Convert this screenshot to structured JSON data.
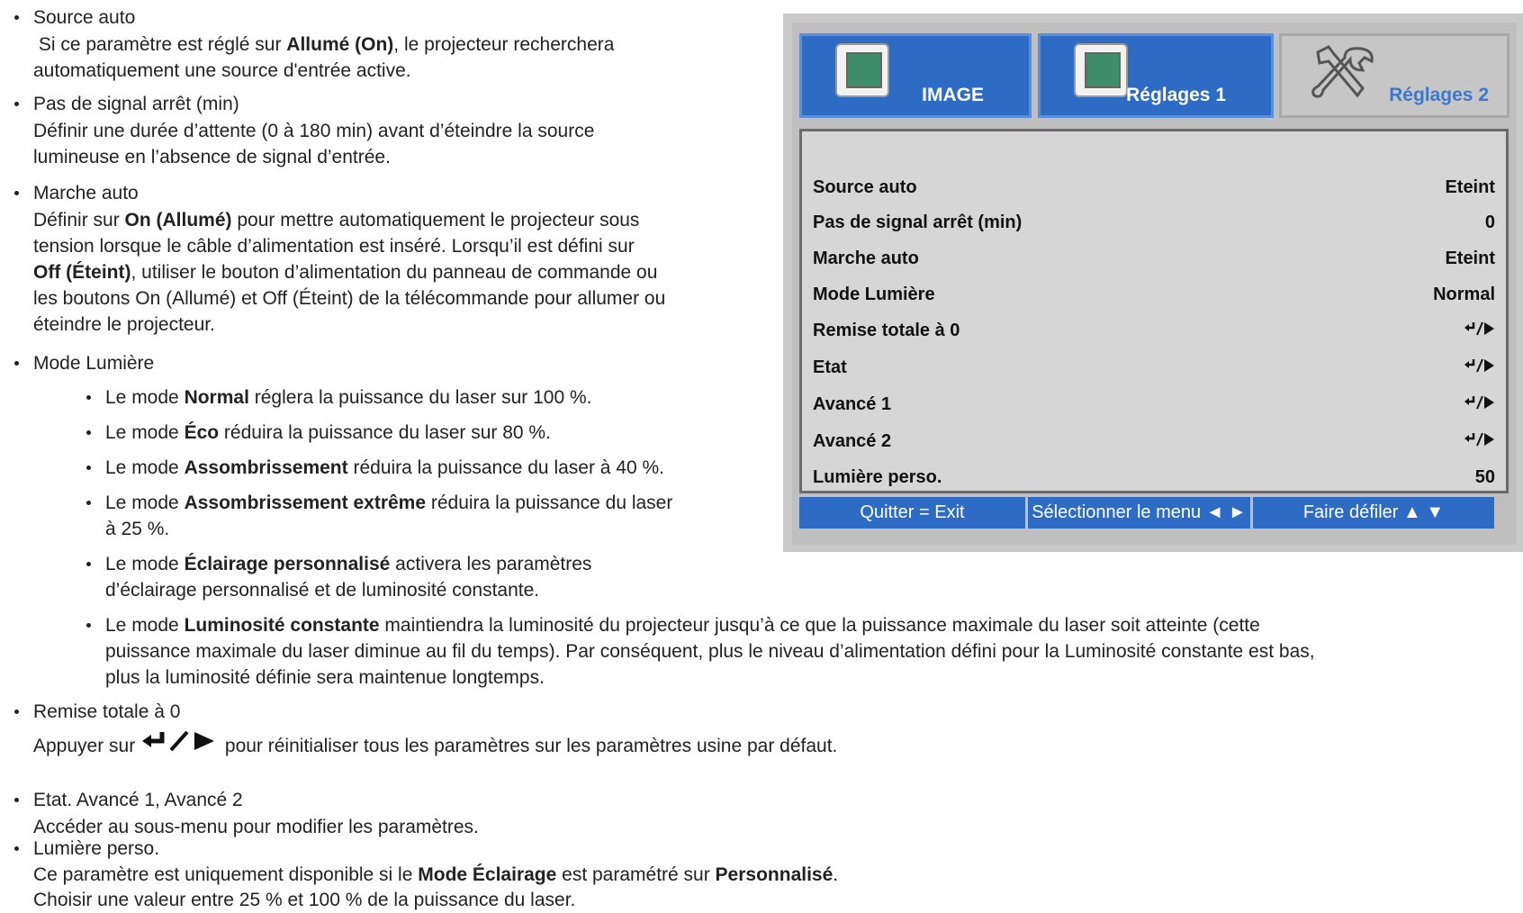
{
  "doc": {
    "b1": {
      "title": "Source auto",
      "l1a": " Si ce paramètre est réglé sur ",
      "l1b": "Allumé (On)",
      "l1c": ", le projecteur recherchera",
      "l2": "automatiquement une source d'entrée active."
    },
    "b2": {
      "title": "Pas de signal arrêt (min)",
      "l1": "Définir une durée d’attente (0 à 180 min) avant d’éteindre la source",
      "l2": "lumineuse en l’absence de signal d’entrée."
    },
    "b3": {
      "title": "Marche auto",
      "l1a": "Définir sur ",
      "l1b": "On (Allumé)",
      "l1c": " pour mettre automatiquement le projecteur sous",
      "l2": "tension lorsque le câble d’alimentation est inséré. Lorsqu’il est défini sur",
      "l3a": "Off (Éteint)",
      "l3b": ", utiliser le bouton d’alimentation du panneau de commande ou",
      "l4": "les boutons On (Allumé) et Off (Éteint) de la télécommande pour allumer ou",
      "l5": "éteindre le projecteur."
    },
    "b4": {
      "title": "Mode Lumière",
      "s1a": "Le mode ",
      "s1b": "Normal",
      "s1c": " réglera la puissance du laser sur 100 %.",
      "s2a": "Le mode ",
      "s2b": "Éco",
      "s2c": " réduira la puissance du laser sur 80 %.",
      "s3a": "Le mode ",
      "s3b": "Assombrissement",
      "s3c": " réduira la puissance du laser à 40 %.",
      "s4a": "Le mode ",
      "s4b": "Assombrissement extrême",
      "s4c": " réduira la puissance du laser",
      "s4d": "à 25 %.",
      "s5a": "Le mode ",
      "s5b": "Éclairage personnalisé",
      "s5c": " activera les paramètres",
      "s5d": "d’éclairage personnalisé et de luminosité constante.",
      "s6a": "Le mode ",
      "s6b": "Luminosité constante",
      "s6c": " maintiendra la luminosité du projecteur jusqu’à ce que la puissance maximale du laser soit atteinte (cette",
      "s6d": "puissance maximale du laser diminue au fil du temps). Par conséquent, plus le niveau d’alimentation défini pour la Luminosité constante est bas,",
      "s6e": "plus la luminosité définie sera maintenue longtemps."
    },
    "b5": {
      "title": "Remise totale à 0",
      "l1a": "Appuyer sur ",
      "l1b": " pour réinitialiser tous les paramètres sur les paramètres usine par défaut."
    },
    "b6": {
      "title": "Etat. Avancé 1, Avancé 2",
      "l1": "Accéder au sous-menu pour modifier les paramètres."
    },
    "b7": {
      "title": "Lumière perso.",
      "l1a": "Ce paramètre est uniquement disponible si le ",
      "l1b": "Mode Éclairage",
      "l1c": " est paramétré sur ",
      "l1d": "Personnalisé",
      "l1e": ".",
      "l2": "Choisir une valeur entre 25 % et 100 % de la puissance du laser."
    }
  },
  "osd": {
    "tabs": [
      {
        "label": "IMAGE",
        "icon": "image-thumbnail-icon"
      },
      {
        "label": "Réglages 1",
        "icon": "image-thumbnail-icon"
      },
      {
        "label": "Réglages 2",
        "icon": "tools-icon"
      }
    ],
    "rows": [
      {
        "label": "Source auto",
        "value": "Eteint"
      },
      {
        "label": "Pas de signal arrêt (min)",
        "value": "0"
      },
      {
        "label": "Marche auto",
        "value": "Eteint"
      },
      {
        "label": "Mode Lumière",
        "value": "Normal"
      },
      {
        "label": "Remise totale à 0",
        "value": ""
      },
      {
        "label": "Etat",
        "value": ""
      },
      {
        "label": "Avancé 1",
        "value": ""
      },
      {
        "label": "Avancé 2",
        "value": ""
      },
      {
        "label": "Lumière perso.",
        "value": "50"
      }
    ],
    "footer": [
      "Quitter = Exit",
      "Sélectionner le menu ◄ ►",
      "Faire défiler ▲ ▼"
    ],
    "colors": {
      "tab_active": "#2e6bc4",
      "tab_label_inactive": "#3a79cf",
      "panel": "#d6d6d6"
    }
  }
}
